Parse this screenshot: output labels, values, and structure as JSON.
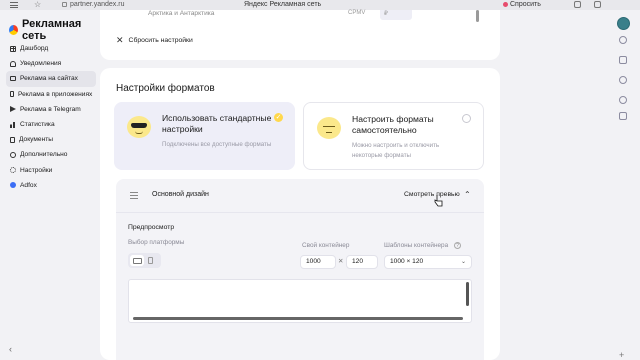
{
  "browser": {
    "url": "partner.yandex.ru",
    "tab_title": "Яндекс Рекламная сеть",
    "help_label": "Спросить"
  },
  "sidebar": {
    "brand": "Рекламная сеть",
    "items": [
      {
        "label": "Дашборд",
        "icon": "dashboard-icon",
        "active": false
      },
      {
        "label": "Уведомления",
        "icon": "bell-icon",
        "active": false
      },
      {
        "label": "Реклама на сайтах",
        "icon": "monitor-icon",
        "active": true
      },
      {
        "label": "Реклама в приложениях",
        "icon": "phone-icon",
        "active": false
      },
      {
        "label": "Реклама в Telegram",
        "icon": "telegram-icon",
        "active": false
      },
      {
        "label": "Статистика",
        "icon": "chart-icon",
        "active": false
      },
      {
        "label": "Документы",
        "icon": "document-icon",
        "active": false
      },
      {
        "label": "Дополнительно",
        "icon": "plus-circle-icon",
        "active": false
      },
      {
        "label": "Настройки",
        "icon": "gear-icon",
        "active": false
      },
      {
        "label": "Adfox",
        "icon": "adfox-icon",
        "active": false
      }
    ]
  },
  "top_card": {
    "region": "Арктика и Антарктика",
    "metric": "CPMV",
    "reset_label": "Сбросить настройки"
  },
  "formats": {
    "title": "Настройки форматов",
    "options": [
      {
        "title": "Использовать стандартные настройки",
        "desc": "Подключены все доступные форматы",
        "selected": true
      },
      {
        "title": "Настроить форматы самостоятельно",
        "desc": "Можно настроить и отключить некоторые форматы",
        "selected": false
      }
    ]
  },
  "design": {
    "label": "Основной дизайн",
    "preview_button": "Смотреть превью",
    "preview_title": "Предпросмотр",
    "platform_label": "Выбор платформы",
    "container_label": "Свой контейнер",
    "templates_label": "Шаблоны контейнера",
    "width": "1000",
    "height": "120",
    "template_value": "1000 × 120"
  },
  "colors": {
    "accent_yellow": "#ffd84c",
    "selected_bg": "#eeeef8"
  }
}
